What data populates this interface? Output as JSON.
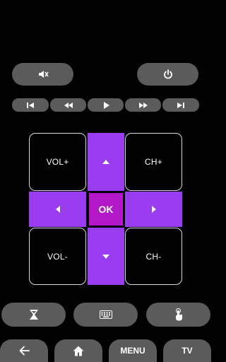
{
  "top_row": {
    "mute_icon": "speaker-muted-icon",
    "power_icon": "power-icon"
  },
  "media_row": {
    "icons": [
      "skip-previous-icon",
      "rewind-icon",
      "play-icon",
      "fast-forward-icon",
      "skip-next-icon"
    ]
  },
  "dpad": {
    "vol_up": "VOL+",
    "vol_down": "VOL-",
    "ch_up": "CH+",
    "ch_down": "CH-",
    "ok": "OK"
  },
  "action_row": {
    "icons": [
      "hourglass-icon",
      "keyboard-icon",
      "touch-icon"
    ]
  },
  "nav_row": {
    "back_icon": "back-arrow-icon",
    "home_icon": "home-icon",
    "menu_label": "MENU",
    "tv_label": "TV"
  },
  "colors": {
    "background": "#000000",
    "button_gray": "#5b5b5b",
    "dpad_purple": "#9b3cf0",
    "ok_magenta": "#b417c8"
  }
}
